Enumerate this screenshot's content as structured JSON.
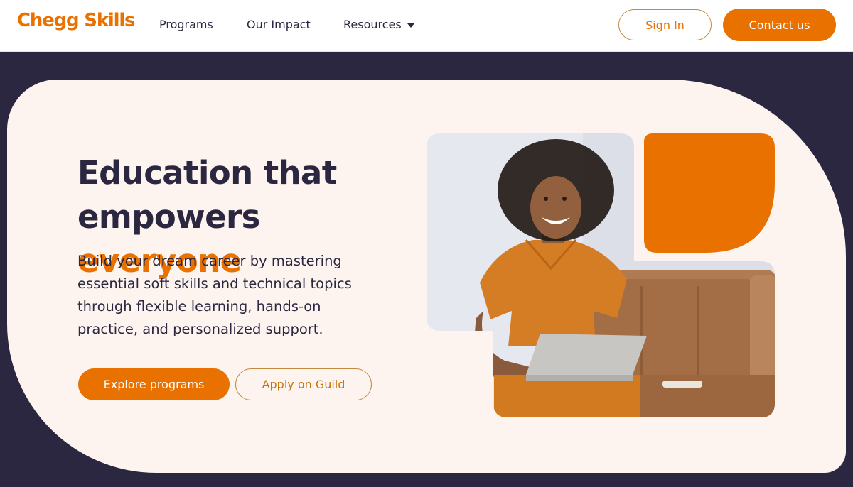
{
  "brand": {
    "logo_text": "Chegg Skills",
    "accent_color": "#e87100",
    "dark_color": "#2b2740"
  },
  "nav": {
    "items": [
      {
        "label": "Programs"
      },
      {
        "label": "Our Impact"
      },
      {
        "label": "Resources",
        "has_dropdown": true,
        "icon": "caret-down-icon"
      }
    ],
    "sign_in": "Sign In",
    "contact": "Contact us"
  },
  "hero": {
    "headline_line1": "Education that",
    "headline_line2": "empowers",
    "headline_accent": "everyone",
    "subtext": "Build your dream career by mastering essential soft skills and technical topics through flexible learning, hands-on practice, and personalized support.",
    "primary_cta": "Explore programs",
    "secondary_cta": "Apply on Guild"
  }
}
